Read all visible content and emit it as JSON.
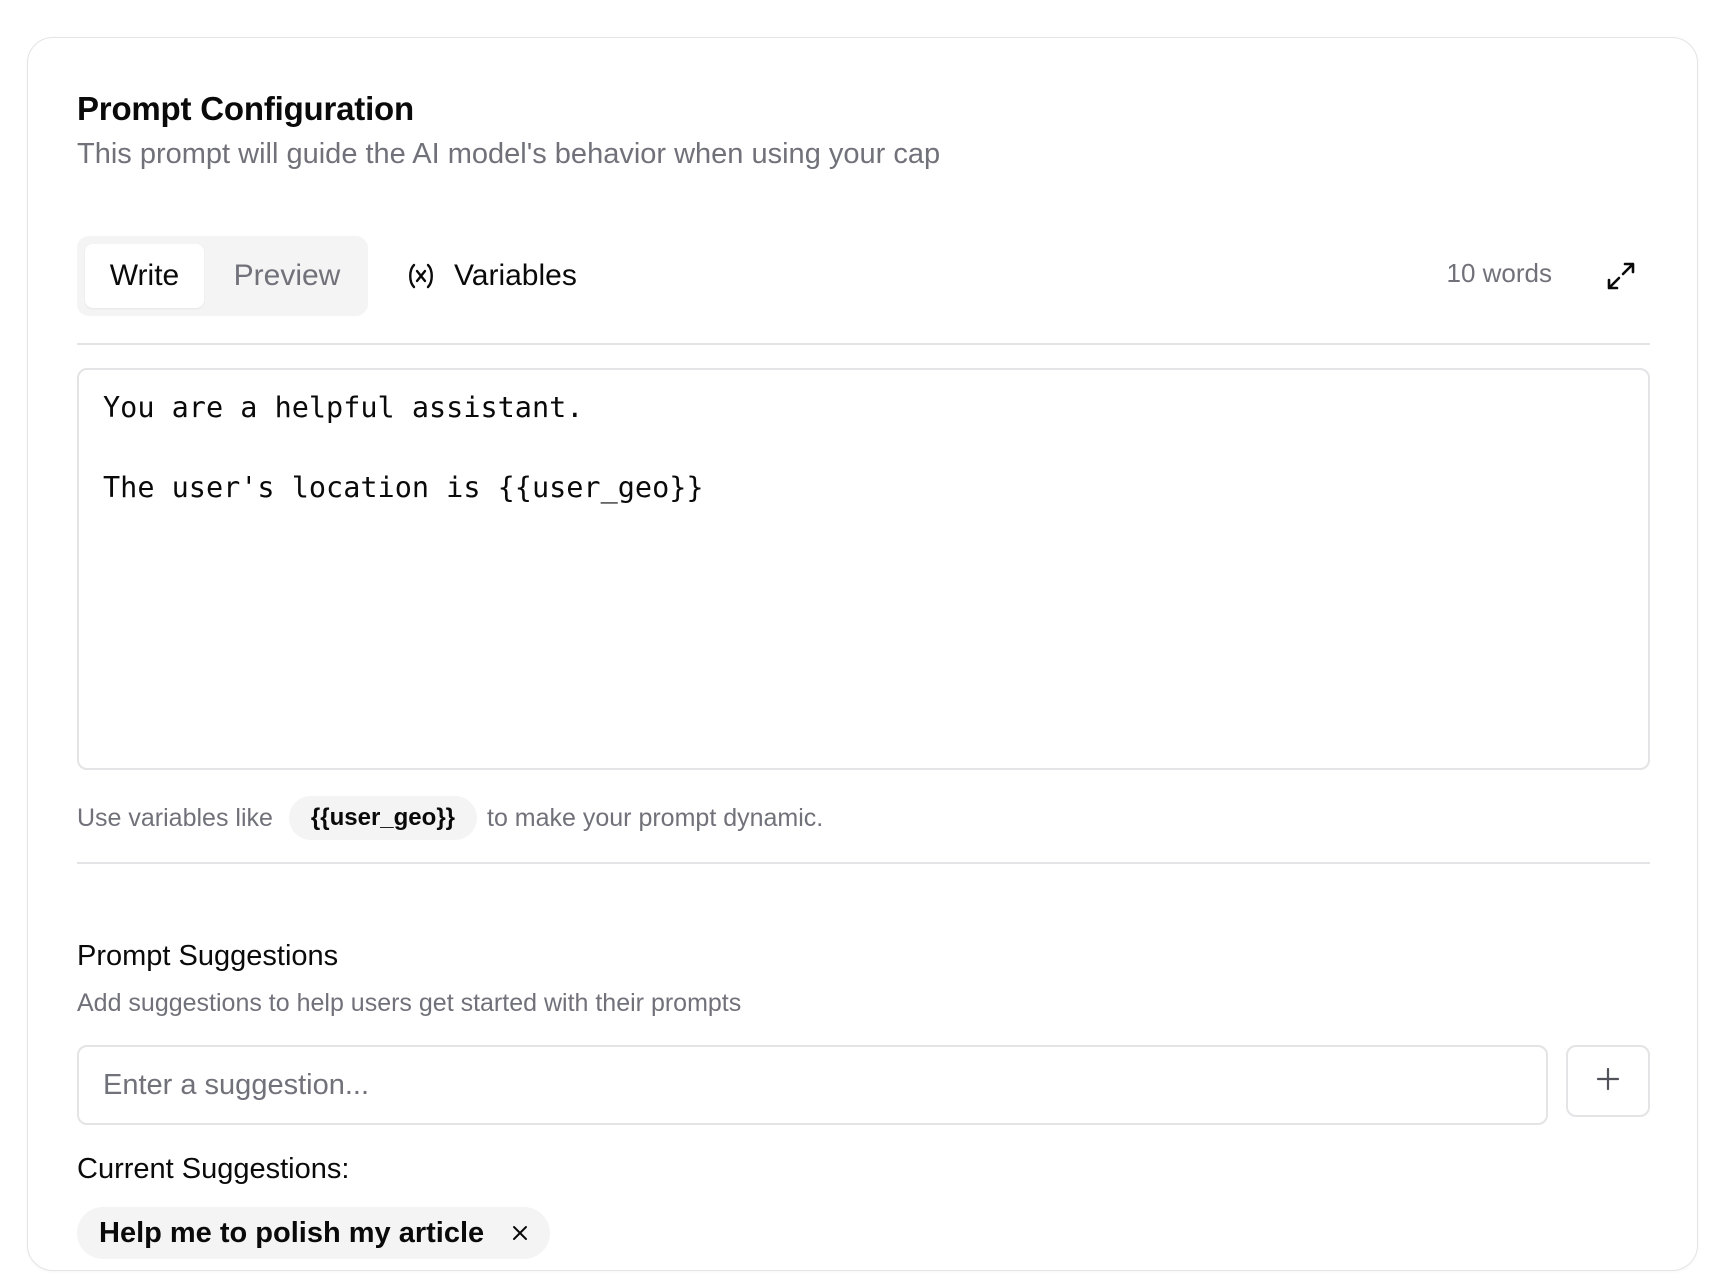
{
  "header": {
    "title": "Prompt Configuration",
    "subtitle": "This prompt will guide the AI model's behavior when using your cap"
  },
  "toolbar": {
    "tabs": [
      {
        "label": "Write",
        "active": true
      },
      {
        "label": "Preview",
        "active": false
      }
    ],
    "variables_label": "Variables",
    "variables_icon": "variable-x-icon",
    "word_count": "10 words",
    "expand_icon": "expand-arrows-icon"
  },
  "editor": {
    "content": "You are a helpful assistant.\n\nThe user's location is {{user_geo}}"
  },
  "hint": {
    "prefix": "Use variables like",
    "variable_example": "{{user_geo}}",
    "suffix": "to make your prompt dynamic."
  },
  "suggestions": {
    "title": "Prompt Suggestions",
    "description": "Add suggestions to help users get started with their prompts",
    "input_placeholder": "Enter a suggestion...",
    "input_value": "",
    "add_icon": "plus-icon",
    "current_title": "Current Suggestions:",
    "items": [
      {
        "label": "Help me to polish my article",
        "remove_icon": "close-icon"
      }
    ]
  },
  "colors": {
    "text_primary": "#0a0a0a",
    "text_muted": "#71717a",
    "border": "#e4e4e7",
    "chip_bg": "#f4f4f5"
  }
}
